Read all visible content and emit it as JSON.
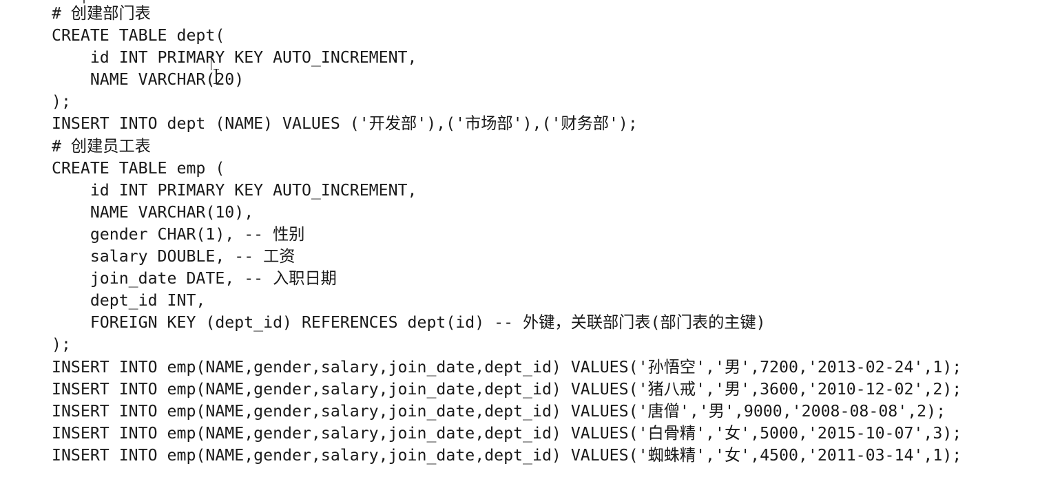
{
  "editor": {
    "lines": [
      "# 创建部门表",
      "CREATE TABLE dept(",
      "    id INT PRIMARY KEY AUTO_INCREMENT,",
      "    NAME VARCHAR(20)",
      ");",
      "INSERT INTO dept (NAME) VALUES ('开发部'),('市场部'),('财务部');",
      "# 创建员工表",
      "CREATE TABLE emp (",
      "    id INT PRIMARY KEY AUTO_INCREMENT,",
      "    NAME VARCHAR(10),",
      "    gender CHAR(1), -- 性别",
      "    salary DOUBLE, -- 工资",
      "    join_date DATE, -- 入职日期",
      "    dept_id INT,",
      "    FOREIGN KEY (dept_id) REFERENCES dept(id) -- 外键，关联部门表(部门表的主键)",
      ");",
      "INSERT INTO emp(NAME,gender,salary,join_date,dept_id) VALUES('孙悟空','男',7200,'2013-02-24',1);",
      "INSERT INTO emp(NAME,gender,salary,join_date,dept_id) VALUES('猪八戒','男',3600,'2010-12-02',2);",
      "INSERT INTO emp(NAME,gender,salary,join_date,dept_id) VALUES('唐僧','男',9000,'2008-08-08',2);",
      "INSERT INTO emp(NAME,gender,salary,join_date,dept_id) VALUES('白骨精','女',5000,'2015-10-07',3);",
      "INSERT INTO emp(NAME,gender,salary,join_date,dept_id) VALUES('蜘蛛精','女',4500,'2011-03-14',1);"
    ]
  },
  "colors": {
    "background": "#ffffff",
    "text": "#1a1a1a"
  }
}
